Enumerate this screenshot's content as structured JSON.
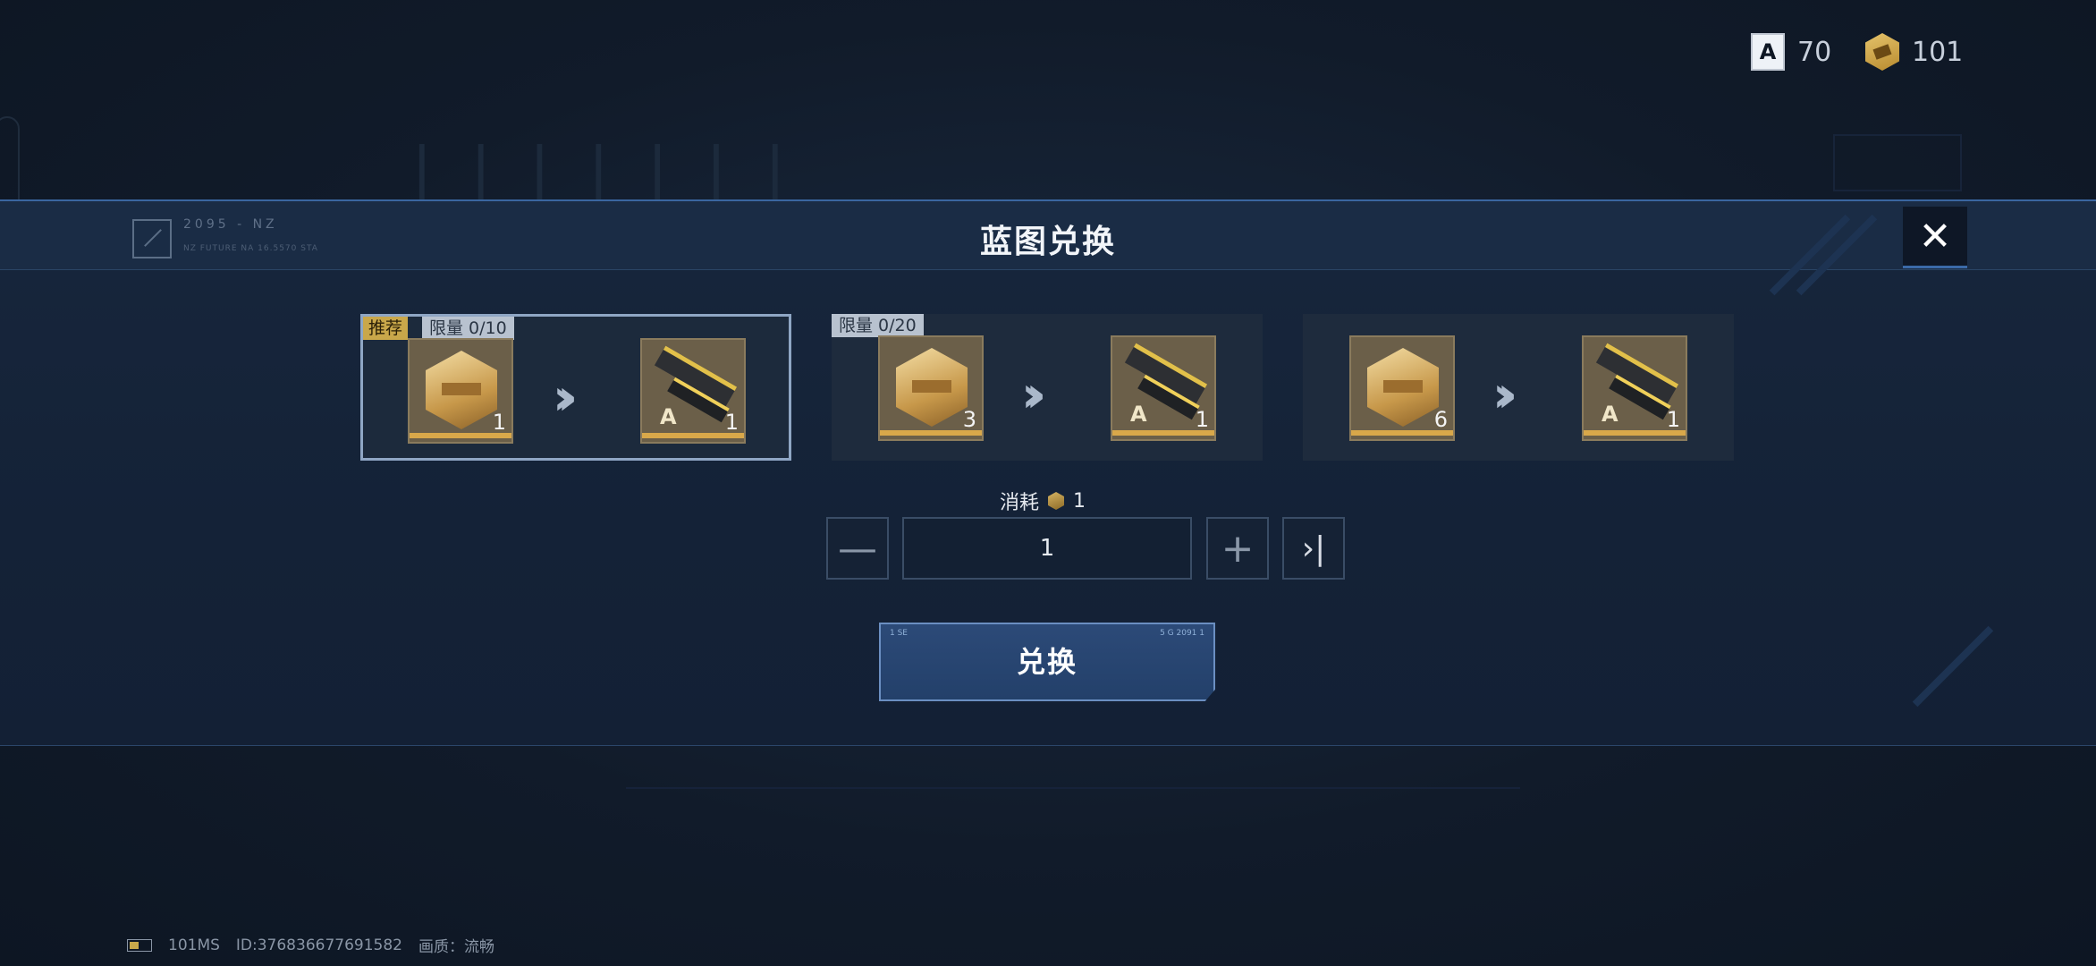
{
  "currency": [
    {
      "icon": "blueprint-icon",
      "value": "70"
    },
    {
      "icon": "token-icon",
      "value": "101"
    }
  ],
  "dialog": {
    "title": "蓝图兑换",
    "deco_code": "2095 - NZ",
    "deco_sub": "NZ FUTURE NA 16.5570 STA"
  },
  "cards": [
    {
      "recommended": "推荐",
      "limit": "限量 0/10",
      "cost_qty": "1",
      "reward_qty": "1",
      "selected": true
    },
    {
      "recommended": null,
      "limit": "限量 0/20",
      "cost_qty": "3",
      "reward_qty": "1",
      "selected": false
    },
    {
      "recommended": null,
      "limit": null,
      "cost_qty": "6",
      "reward_qty": "1",
      "selected": false
    }
  ],
  "consume": {
    "label": "消耗",
    "value": "1"
  },
  "quantity": {
    "value": "1"
  },
  "exchange_button": {
    "label": "兑换",
    "tiny_left": "1 SE",
    "tiny_right": "5 G 2091 1"
  },
  "footer": {
    "ping": "101MS",
    "id": "ID:376836677691582",
    "quality": "画质：流畅"
  },
  "colors": {
    "accent": "#3b6aa8",
    "gold": "#d9a84a",
    "bg": "#101a28"
  }
}
